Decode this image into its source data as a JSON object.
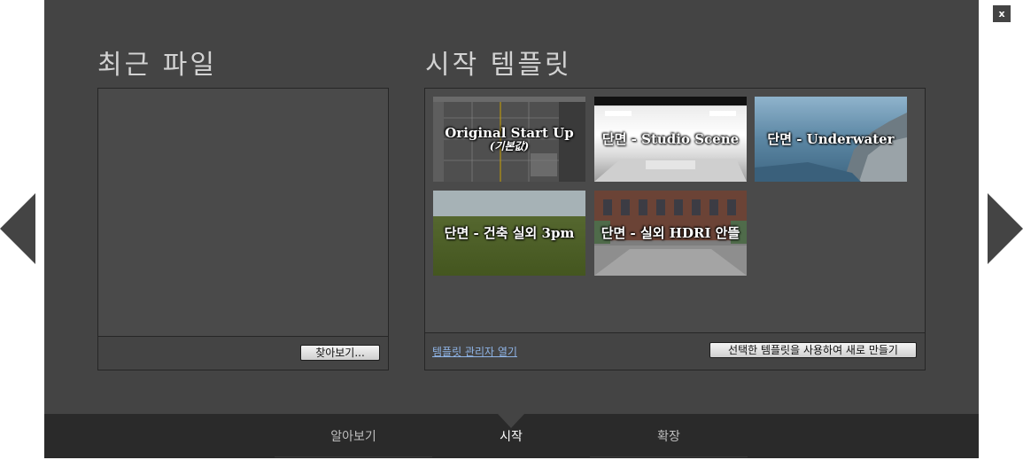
{
  "recent": {
    "heading": "최근 파일",
    "browse_label": "찾아보기..."
  },
  "templates": {
    "heading": "시작 템플릿",
    "items": [
      {
        "label": "Original Start Up",
        "sub": "(기본값)"
      },
      {
        "label": "단면 - Studio Scene"
      },
      {
        "label": "단면 - Underwater"
      },
      {
        "label": "단면 - 건축 실외 3pm"
      },
      {
        "label": "단면 - 실외 HDRI 안뜰"
      }
    ],
    "manager_link": "템플릿 관리자 열기",
    "create_label": "선택한 템플릿을 사용하여 새로 만들기"
  },
  "close_label": "x",
  "tabs": [
    {
      "label": "알아보기"
    },
    {
      "label": "시작"
    },
    {
      "label": "확장"
    }
  ],
  "colors": {
    "panel": "#444444",
    "bottom_bar": "#2a2a2a",
    "link": "#8fb4e6"
  }
}
